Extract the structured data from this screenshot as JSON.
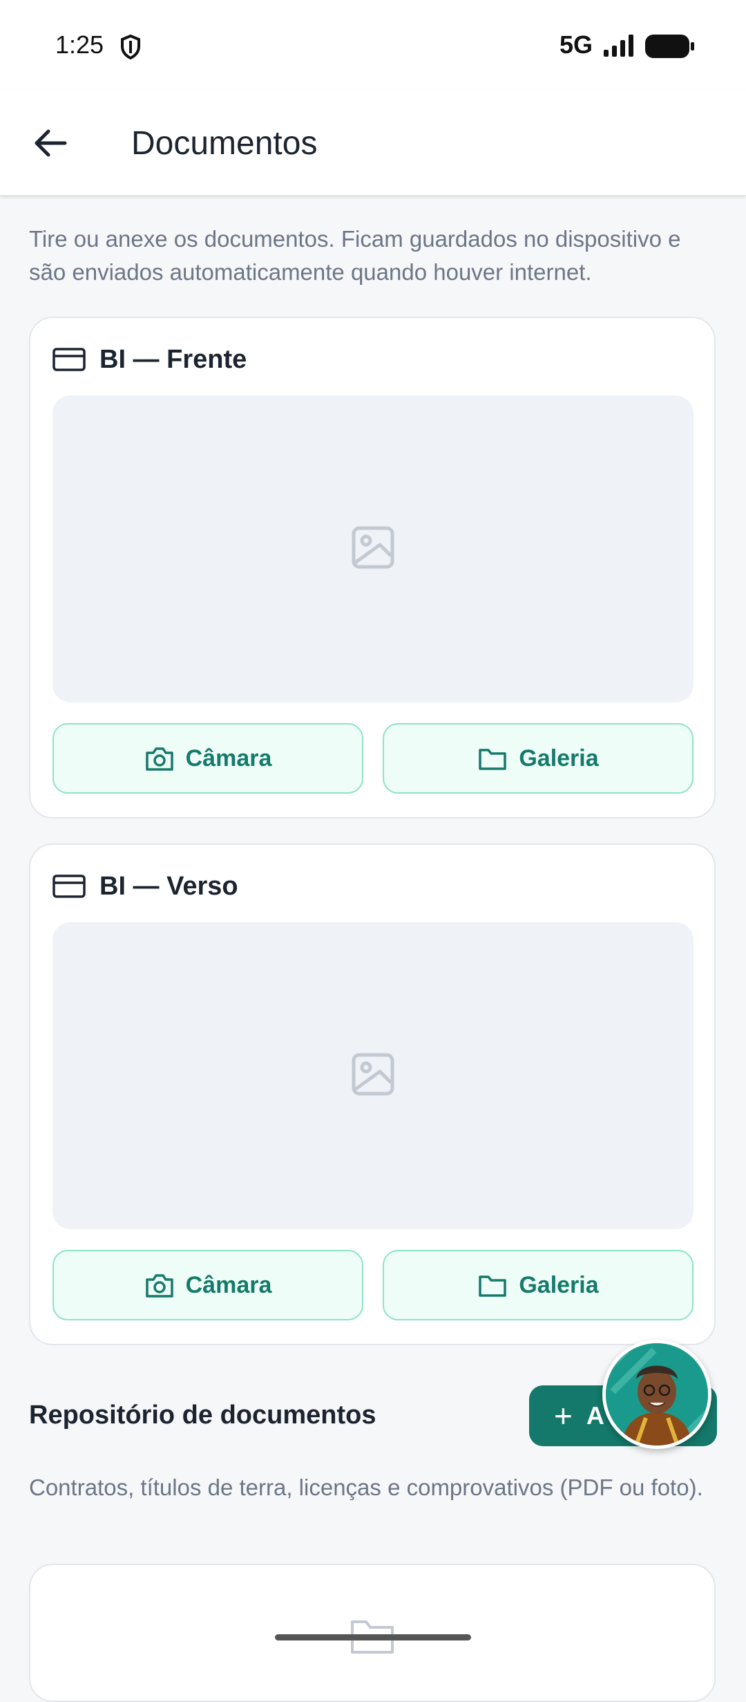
{
  "status_bar": {
    "time": "1:25",
    "network": "5G",
    "icons": [
      "shield-icon",
      "signal-icon",
      "battery-icon"
    ]
  },
  "app_bar": {
    "title": "Documentos",
    "back_icon": "arrow-left-icon"
  },
  "intro_text": "Tire ou anexe os documentos. Ficam guardados no dispositivo e são enviados automaticamente quando houver internet.",
  "documents": [
    {
      "title": "BI — Frente",
      "icon": "id-card-icon",
      "camera_label": "Câmara",
      "gallery_label": "Galeria"
    },
    {
      "title": "BI — Verso",
      "icon": "id-card-icon",
      "camera_label": "Câmara",
      "gallery_label": "Galeria"
    }
  ],
  "repository": {
    "title": "Repositório de documentos",
    "add_button_label": "A",
    "description": "Contratos, títulos de terra, licenças e comprovativos (PDF ou foto).",
    "empty_icon": "folder-icon"
  },
  "colors": {
    "accent": "#14786a",
    "button_bg": "#eefdf8",
    "button_border": "#8ee2c8",
    "text_primary": "#1c2430",
    "text_secondary": "#6b7686",
    "background": "#f6f7f9"
  }
}
